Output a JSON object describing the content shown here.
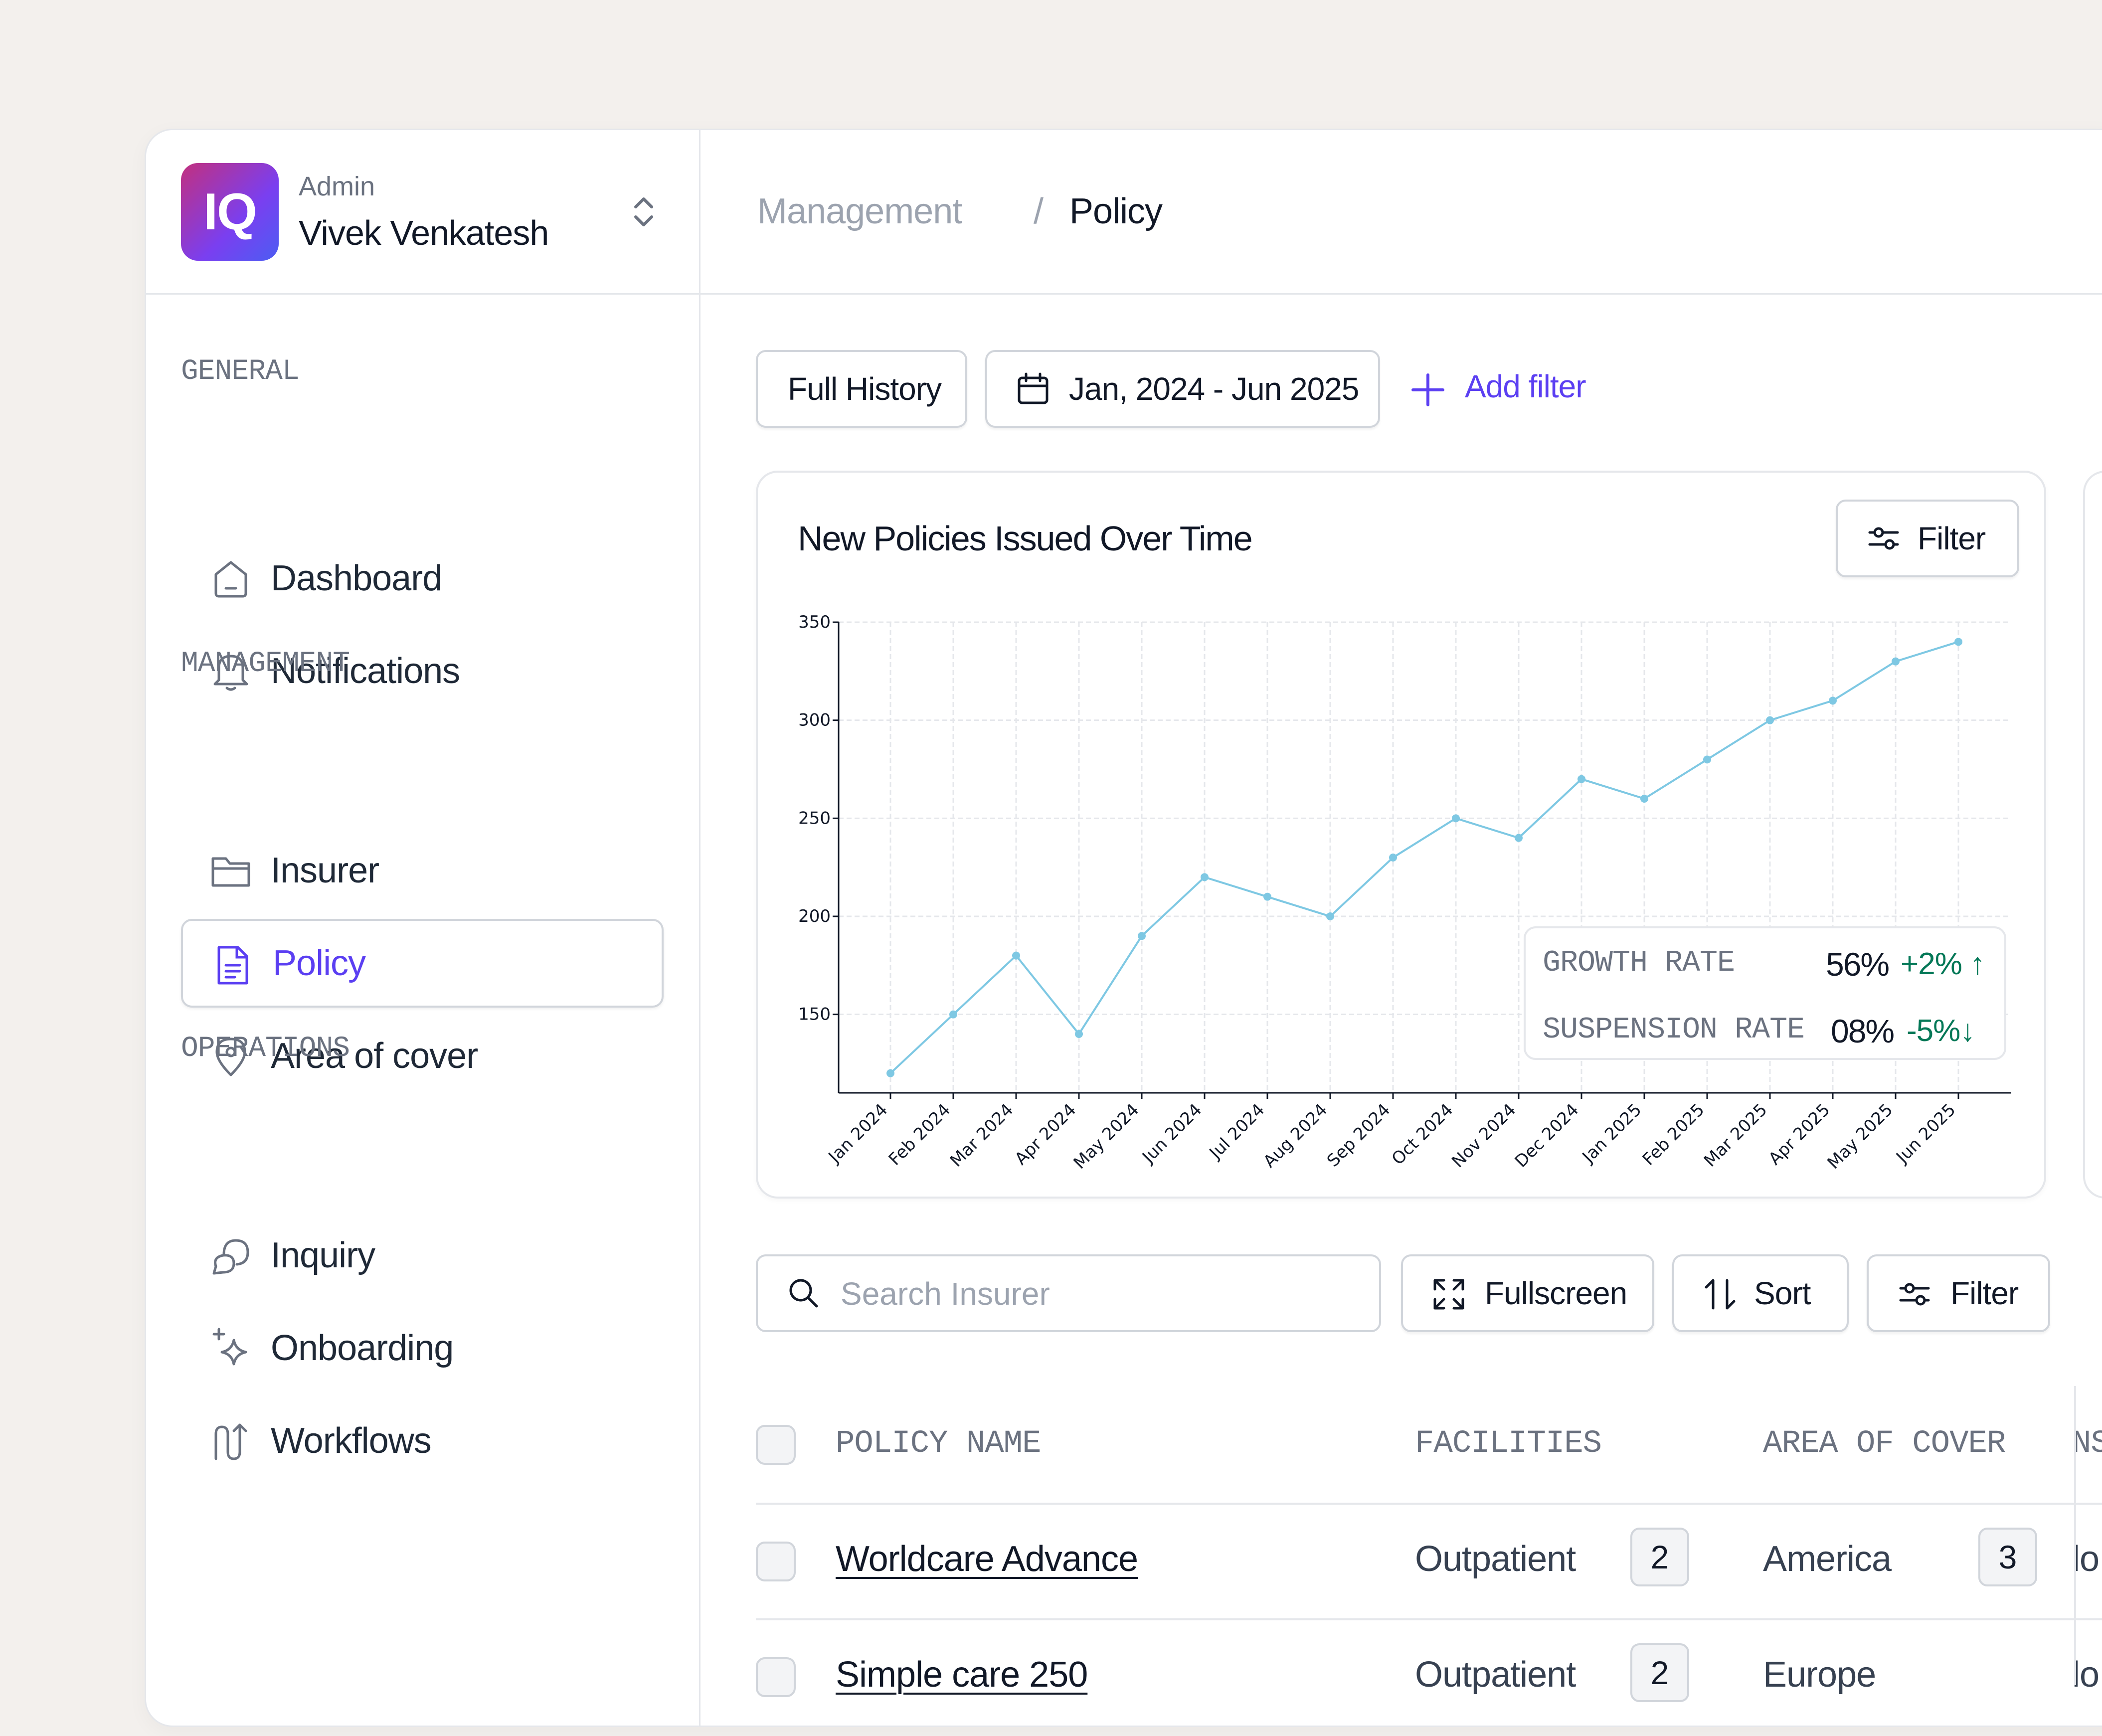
{
  "profile": {
    "logo_text": "IQ",
    "role": "Admin",
    "name": "Vivek Venkatesh"
  },
  "sidebar": {
    "sections": [
      {
        "label": "GENERAL"
      },
      {
        "label": "MANAGEMENT"
      },
      {
        "label": "OPERATIONS"
      }
    ],
    "items": [
      {
        "label": "Dashboard",
        "icon": "home-icon"
      },
      {
        "label": "Notifications",
        "icon": "bell-icon"
      },
      {
        "label": "Insurer",
        "icon": "folder-icon"
      },
      {
        "label": "Policy",
        "icon": "document-icon",
        "active": true
      },
      {
        "label": "Area of cover",
        "icon": "map-pin-icon"
      },
      {
        "label": "Inquiry",
        "icon": "chat-icon"
      },
      {
        "label": "Onboarding",
        "icon": "sparkle-icon"
      },
      {
        "label": "Workflows",
        "icon": "workflow-icon"
      }
    ]
  },
  "breadcrumb": {
    "parent": "Management",
    "separator": "/",
    "current": "Policy"
  },
  "filters": {
    "history_label": "Full History",
    "date_range": "Jan, 2024 - Jun 2025",
    "add_filter_label": "Add filter"
  },
  "chart_card": {
    "title": "New Policies Issued Over Time",
    "filter_label": "Filter",
    "stats": {
      "growth_label": "GROWTH RATE",
      "growth_value": "56%",
      "growth_delta": "+2%",
      "suspension_label": "SUSPENSION RATE",
      "suspension_value": "08%",
      "suspension_delta": "-5%"
    }
  },
  "chart_data": {
    "type": "line",
    "title": "New Policies Issued Over Time",
    "categories": [
      "Jan 2024",
      "Feb 2024",
      "Mar 2024",
      "Apr 2024",
      "May 2024",
      "Jun 2024",
      "Jul 2024",
      "Aug 2024",
      "Sep 2024",
      "Oct 2024",
      "Nov 2024",
      "Dec 2024",
      "Jan 2025",
      "Feb 2025",
      "Mar 2025",
      "Apr 2025",
      "May 2025",
      "Jun 2025"
    ],
    "series": [
      {
        "values": [
          120,
          150,
          180,
          140,
          190,
          220,
          210,
          200,
          230,
          250,
          240,
          270,
          260,
          280,
          300,
          310,
          330,
          340
        ]
      }
    ],
    "ylim": [
      110,
      350
    ],
    "yticks": [
      150,
      200,
      250,
      300,
      350
    ],
    "grid": true,
    "color": "#7ec8e3"
  },
  "toolbar": {
    "search_placeholder": "Search Insurer",
    "fullscreen_label": "Fullscreen",
    "sort_label": "Sort",
    "filter_label": "Filter"
  },
  "table": {
    "headers": [
      "POLICY NAME",
      "FACILITIES",
      "AREA OF COVER",
      "NS"
    ],
    "rows": [
      {
        "name": "Worldcare Advance",
        "facility": "Outpatient",
        "facility_count": "2",
        "area": "America",
        "area_count": "3",
        "extra": "lo"
      },
      {
        "name": "Simple care 250",
        "facility": "Outpatient",
        "facility_count": "2",
        "area": "Europe",
        "area_count": "",
        "extra": "lo"
      }
    ]
  },
  "colors": {
    "accent": "#5b3ff2",
    "positive": "#047857",
    "line": "#7ec8e3"
  }
}
